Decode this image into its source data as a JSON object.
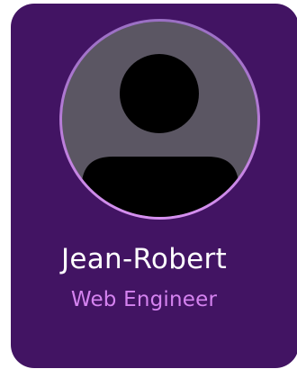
{
  "profile": {
    "name": "Jean-Robert",
    "role": "Web Engineer",
    "avatar_icon": "user-silhouette-icon"
  },
  "colors": {
    "card_background": "#421463",
    "avatar_background": "#5b5663",
    "ring_gradient_start": "#9a6fc4",
    "ring_gradient_end": "#d690f0",
    "name_text": "#ffffff",
    "role_text": "#d583f0"
  }
}
